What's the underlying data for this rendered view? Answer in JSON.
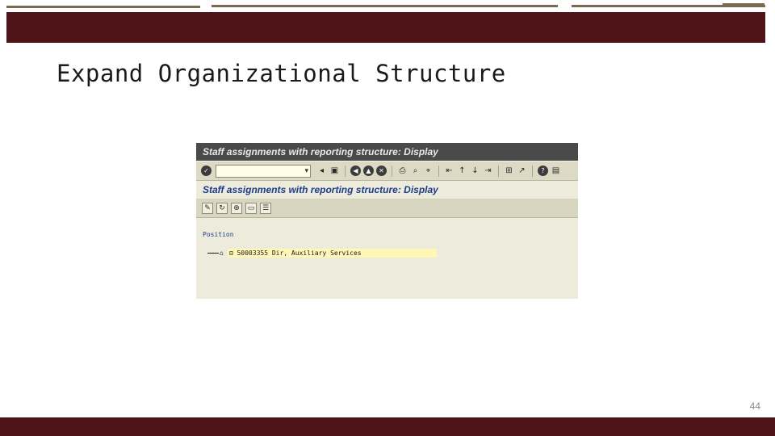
{
  "slide": {
    "title": "Expand  Organizational  Structure",
    "page_number": "44",
    "colors": {
      "band": "#4e1417",
      "deco_line": "#7a6a4f"
    }
  },
  "sap_window": {
    "title": "Staff assignments with reporting structure: Display",
    "subtitle": "Staff assignments with reporting structure: Display",
    "command_field": {
      "value": ""
    },
    "tree": {
      "header": "Position",
      "nodes": [
        {
          "prefix": "⊟",
          "label": "50003355 Dir, Auxiliary Services"
        }
      ]
    },
    "colors": {
      "titlebar": "#4a4a4a",
      "toolbar": "#dcdac5",
      "subtitle_text": "#1d3c8c",
      "highlight": "#fff7b8"
    }
  }
}
